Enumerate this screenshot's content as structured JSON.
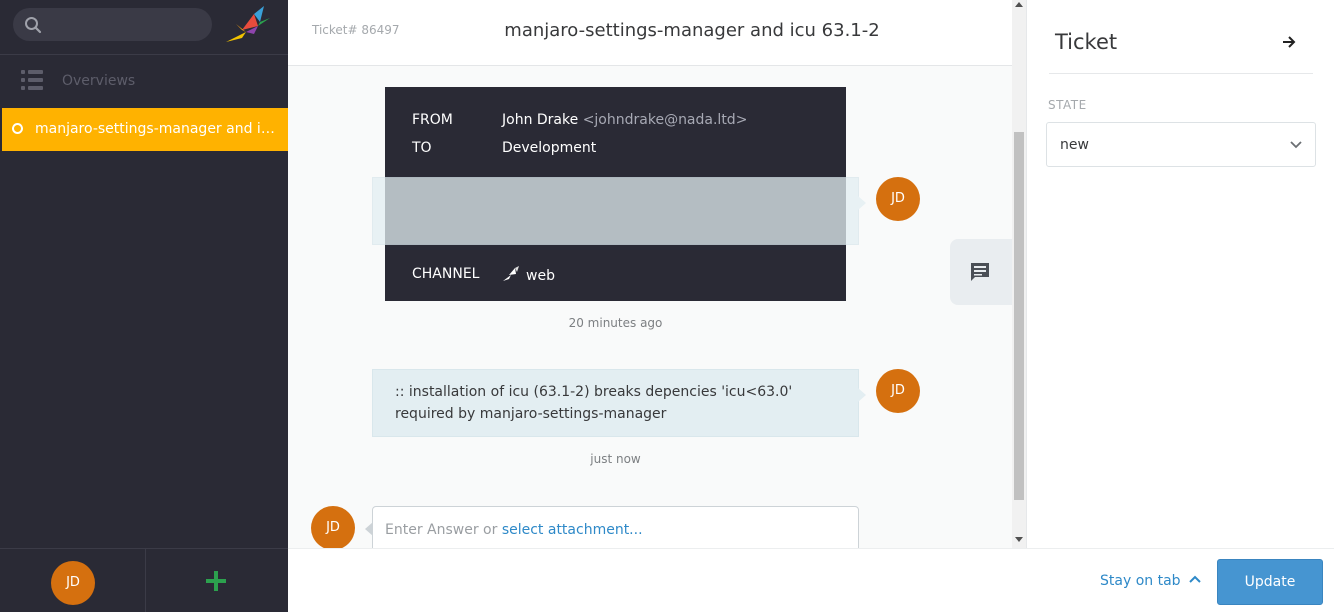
{
  "sidebar": {
    "search": {
      "placeholder": "",
      "icon": "search-icon"
    },
    "logo": "zammad-bird-logo",
    "overviews_label": "Overviews",
    "open_ticket": "manjaro-settings-manager and icu 63.1-2",
    "user_avatar": "JD",
    "add_icon": "plus-icon"
  },
  "header": {
    "ticket_number": "Ticket# 86497",
    "title": "manjaro-settings-manager and icu 63.1-2"
  },
  "article_meta": {
    "from_key": "FROM",
    "from_name": "John Drake",
    "from_email": "<johndrake@nada.ltd>",
    "to_key": "TO",
    "to_value": "Development",
    "channel_key": "CHANNEL",
    "channel_value": "web",
    "channel_icon": "web-bird-icon"
  },
  "articles": [
    {
      "avatar": "JD",
      "text_line1": ":: installation of icu (63.1-2) breaks depencies 'icu<63.0'",
      "text_line2": "required by manjaro-settings-manager",
      "timestamp": "just now"
    }
  ],
  "first_article": {
    "avatar": "JD",
    "timestamp": "20 minutes ago"
  },
  "reply": {
    "avatar": "JD",
    "placeholder": "Enter Answer or ",
    "attach_link": "select attachment..."
  },
  "panel": {
    "title": "Ticket",
    "state_label": "STATE",
    "state_value": "new"
  },
  "bottom": {
    "stay_on_tab": "Stay on tab",
    "update_label": "Update"
  },
  "colors": {
    "sidebar_bg": "#2a2a35",
    "active_ticket": "#ffb200",
    "avatar": "#d5700f",
    "accent_blue": "#4695d1",
    "add_green": "#2ca14e"
  }
}
